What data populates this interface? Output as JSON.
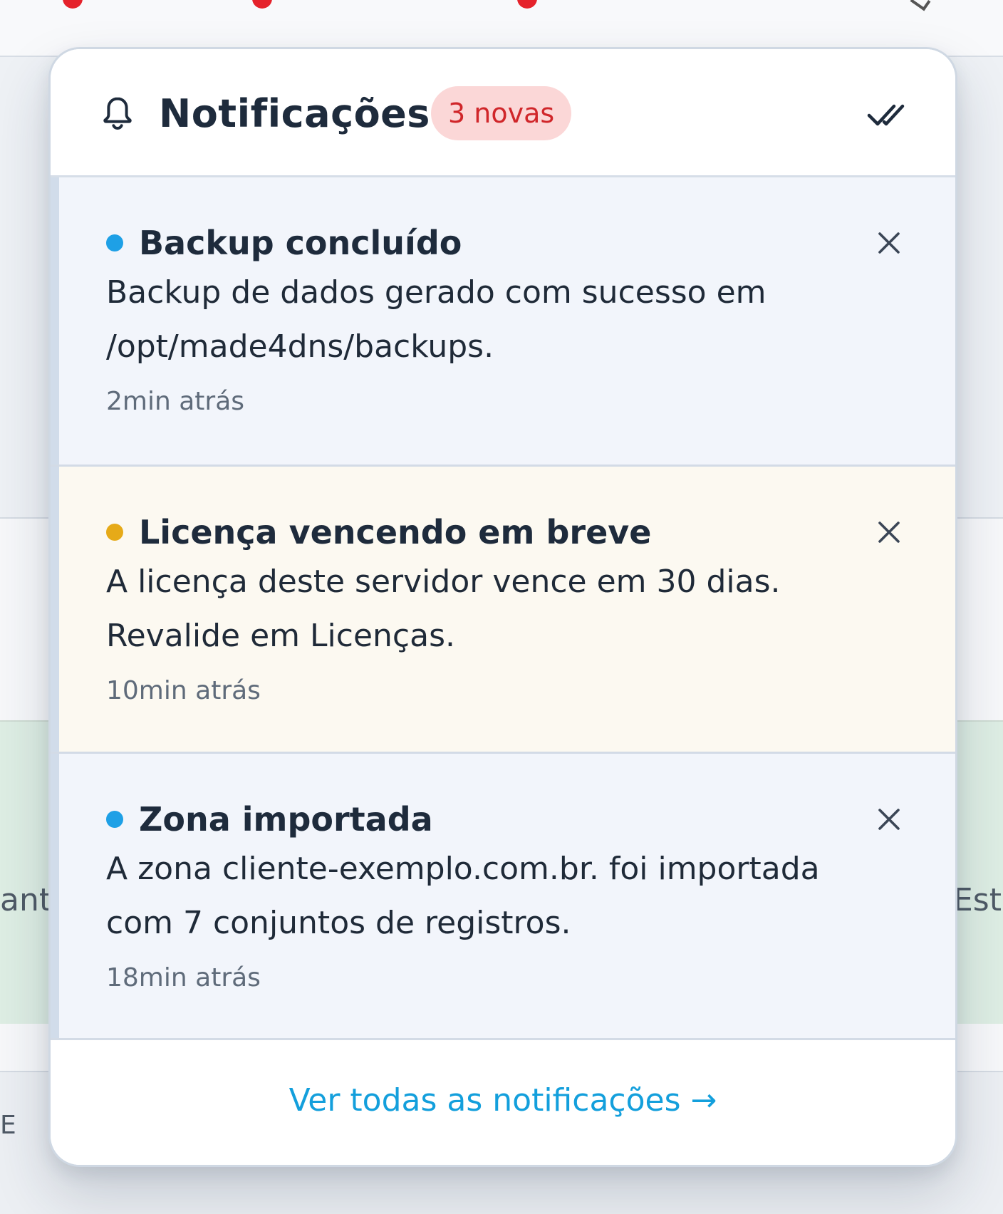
{
  "background": {
    "row_text_left": "ant",
    "row_text_right": "Este",
    "bottom_text_left": "E"
  },
  "notifications_panel": {
    "title": "Notificações",
    "new_count_badge": "3 novas",
    "header_icon": "bell-icon",
    "mark_all_read_icon": "double-check-icon",
    "items": [
      {
        "title": "Backup concluído",
        "body": "Backup de dados gerado com sucesso em /opt/made4dns/backups.",
        "time": "2min atrás",
        "status_color": "#1ea0e6",
        "close_icon": "close-icon"
      },
      {
        "title": "Licença vencendo em breve",
        "body": "A licença deste servidor vence em 30 dias. Revalide em Licenças.",
        "time": "10min atrás",
        "status_color": "#e6aa18",
        "close_icon": "close-icon"
      },
      {
        "title": "Zona importada",
        "body": "A zona cliente-exemplo.com.br. foi importada com 7 conjuntos de registros.",
        "time": "18min atrás",
        "status_color": "#1ea0e6",
        "close_icon": "close-icon"
      }
    ],
    "footer_link": "Ver todas as notificações →"
  },
  "colors": {
    "accent_link": "#139fdc",
    "badge_bg": "#fbd7d7",
    "badge_text": "#d0262a",
    "info_dot": "#1ea0e6",
    "warning_dot": "#e6aa18",
    "warning_bg": "#fcf9f1",
    "info_bg": "#f2f5fb"
  }
}
